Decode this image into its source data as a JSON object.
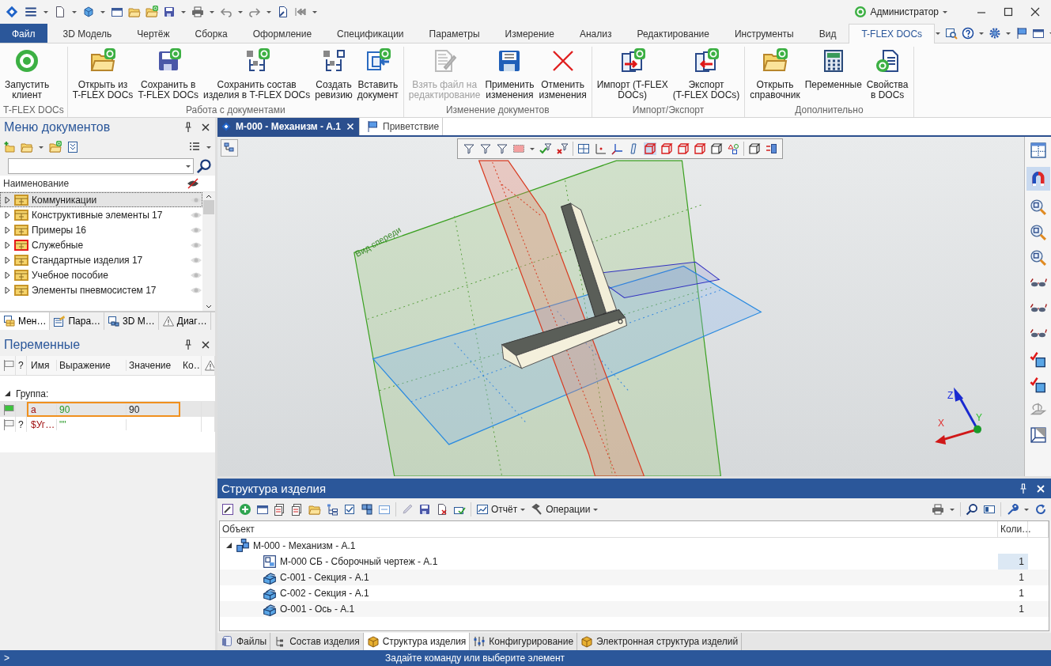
{
  "title_bar": {
    "user": "Администратор"
  },
  "ribbon_tabs": [
    {
      "label": "Файл",
      "kind": "backstage",
      "selected": false
    },
    {
      "label": "3D Модель",
      "kind": "tab",
      "selected": false
    },
    {
      "label": "Чертёж",
      "kind": "tab",
      "selected": false
    },
    {
      "label": "Сборка",
      "kind": "tab",
      "selected": false
    },
    {
      "label": "Оформление",
      "kind": "tab",
      "selected": false
    },
    {
      "label": "Спецификации",
      "kind": "tab",
      "selected": false
    },
    {
      "label": "Параметры",
      "kind": "tab",
      "selected": false
    },
    {
      "label": "Измерение",
      "kind": "tab",
      "selected": false
    },
    {
      "label": "Анализ",
      "kind": "tab",
      "selected": false
    },
    {
      "label": "Редактирование",
      "kind": "tab",
      "selected": false
    },
    {
      "label": "Инструменты",
      "kind": "tab",
      "selected": false
    },
    {
      "label": "Вид",
      "kind": "tab",
      "selected": false
    },
    {
      "label": "T-FLEX DOCs",
      "kind": "tab",
      "selected": true
    }
  ],
  "ribbon_groups": [
    {
      "label": "T-FLEX DOCs",
      "buttons": [
        {
          "label": "Запустить\nклиент",
          "disabled": false
        }
      ]
    },
    {
      "label": "Работа с документами",
      "buttons": [
        {
          "label": "Открыть из\nT-FLEX DOCs",
          "disabled": false
        },
        {
          "label": "Сохранить в\nT-FLEX DOCs",
          "disabled": false
        },
        {
          "label": "Сохранить состав\nизделия в T-FLEX DOCs",
          "disabled": false
        },
        {
          "label": "Создать\nревизию",
          "disabled": false
        },
        {
          "label": "Вставить\nдокумент",
          "disabled": false
        }
      ]
    },
    {
      "label": "Изменение документов",
      "buttons": [
        {
          "label": "Взять файл на\nредактирование",
          "disabled": true
        },
        {
          "label": "Применить\nизменения",
          "disabled": false
        },
        {
          "label": "Отменить\nизменения",
          "disabled": false
        }
      ]
    },
    {
      "label": "Импорт/Экспорт",
      "buttons": [
        {
          "label": "Импорт (T-FLEX\nDOCs)",
          "disabled": false
        },
        {
          "label": "Экспорт\n(T-FLEX DOCs)",
          "disabled": false
        }
      ]
    },
    {
      "label": "Дополнительно",
      "buttons": [
        {
          "label": "Открыть\nсправочник",
          "disabled": false
        },
        {
          "label": "Переменные",
          "disabled": false
        },
        {
          "label": "Свойства\nв DOCs",
          "disabled": false
        }
      ]
    }
  ],
  "documents_panel": {
    "title": "Меню документов",
    "column": "Наименование",
    "items": [
      {
        "label": "Коммуникации",
        "expanded": false,
        "selected": true,
        "color": "#c8962a"
      },
      {
        "label": "Конструктивные элементы 17",
        "expanded": false,
        "selected": false,
        "color": "#c8962a"
      },
      {
        "label": "Примеры 16",
        "expanded": false,
        "selected": false,
        "color": "#c8962a"
      },
      {
        "label": "Служебные",
        "expanded": false,
        "selected": false,
        "color": "#e81818"
      },
      {
        "label": "Стандартные изделия 17",
        "expanded": false,
        "selected": false,
        "color": "#c8962a"
      },
      {
        "label": "Учебное пособие",
        "expanded": false,
        "selected": false,
        "color": "#c8962a"
      },
      {
        "label": "Элементы пневмосистем 17",
        "expanded": false,
        "selected": false,
        "color": "#c8962a"
      }
    ],
    "tabs": [
      {
        "label": "Мен…",
        "selected": true
      },
      {
        "label": "Пара…",
        "selected": false
      },
      {
        "label": "3D М…",
        "selected": false
      },
      {
        "label": "Диаг…",
        "selected": false
      }
    ]
  },
  "variables_panel": {
    "title": "Переменные",
    "columns": [
      "?",
      "Имя",
      "Выражение",
      "Значение",
      "Ко…"
    ],
    "group": {
      "label": "Группа:",
      "expanded": true
    },
    "rows": [
      {
        "flagged": true,
        "name": "a",
        "expression": "90",
        "value": "90",
        "selected": true
      },
      {
        "flagged": false,
        "question": "?",
        "name": "$Уг…",
        "expression": "\"\"",
        "selected": false
      }
    ]
  },
  "document_tabs": [
    {
      "label": "М-000 - Механизм - А.1",
      "selected": true
    },
    {
      "label": "Приветствие",
      "selected": false
    }
  ],
  "viewport": {
    "plane_label": "Вид спереди",
    "axes": [
      "X",
      "Y",
      "Z"
    ]
  },
  "structure_panel": {
    "title": "Структура изделия",
    "toolbar": [
      {
        "label": "Отчёт"
      },
      {
        "label": "Операции"
      }
    ],
    "columns": [
      "Объект",
      "Коли…"
    ],
    "tree": [
      {
        "kind": "assembly",
        "label": "М-000 - Механизм - А.1",
        "expanded": true,
        "selected": false,
        "children": [
          {
            "kind": "drawing",
            "label": "М-000 СБ - Сборочный чертеж - А.1",
            "quantity": "1",
            "selected": true
          },
          {
            "kind": "part",
            "label": "С-001 - Секция - А.1",
            "quantity": "1",
            "selected": false
          },
          {
            "kind": "part",
            "label": "С-002 - Секция - А.1",
            "quantity": "1",
            "selected": false
          },
          {
            "kind": "part",
            "label": "О-001 - Ось - А.1",
            "quantity": "1",
            "selected": false
          }
        ]
      }
    ]
  },
  "bottom_tabs": [
    {
      "label": "Файлы",
      "selected": false
    },
    {
      "label": "Состав изделия",
      "selected": false
    },
    {
      "label": "Структура изделия",
      "selected": true
    },
    {
      "label": "Конфигурирование",
      "selected": false
    },
    {
      "label": "Электронная структура изделий",
      "selected": false
    }
  ],
  "status_bar": {
    "prompt": ">",
    "message": "Задайте команду или выберите элемент"
  }
}
